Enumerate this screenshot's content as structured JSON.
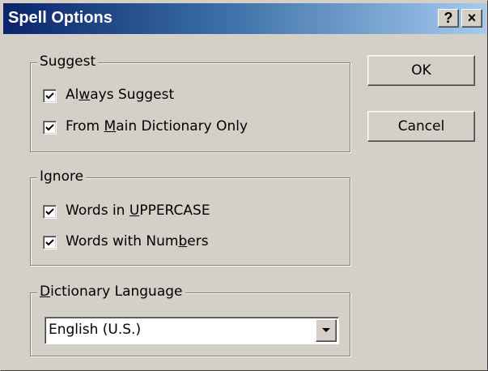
{
  "window": {
    "title": "Spell Options",
    "help_glyph": "?",
    "close_glyph": "×"
  },
  "suggest": {
    "label": "Suggest",
    "always_suggest": {
      "pre": "Al",
      "key": "w",
      "post": "ays Suggest",
      "checked": true
    },
    "main_dictionary_only": {
      "pre": "From ",
      "key": "M",
      "post": "ain Dictionary Only",
      "checked": true
    }
  },
  "ignore": {
    "label": "Ignore",
    "uppercase": {
      "pre": "Words in ",
      "key": "U",
      "post": "PPERCASE",
      "checked": true
    },
    "numbers": {
      "pre": "Words with Num",
      "key": "b",
      "post": "ers",
      "checked": true
    }
  },
  "dictionary_language": {
    "label_key": "D",
    "label_post": "ictionary Language",
    "selected": "English (U.S.)"
  },
  "buttons": {
    "ok": "OK",
    "cancel": "Cancel"
  },
  "icons": {
    "check": "check-icon",
    "dropdown": "dropdown-arrow-icon",
    "help": "help-icon",
    "close": "close-icon"
  }
}
